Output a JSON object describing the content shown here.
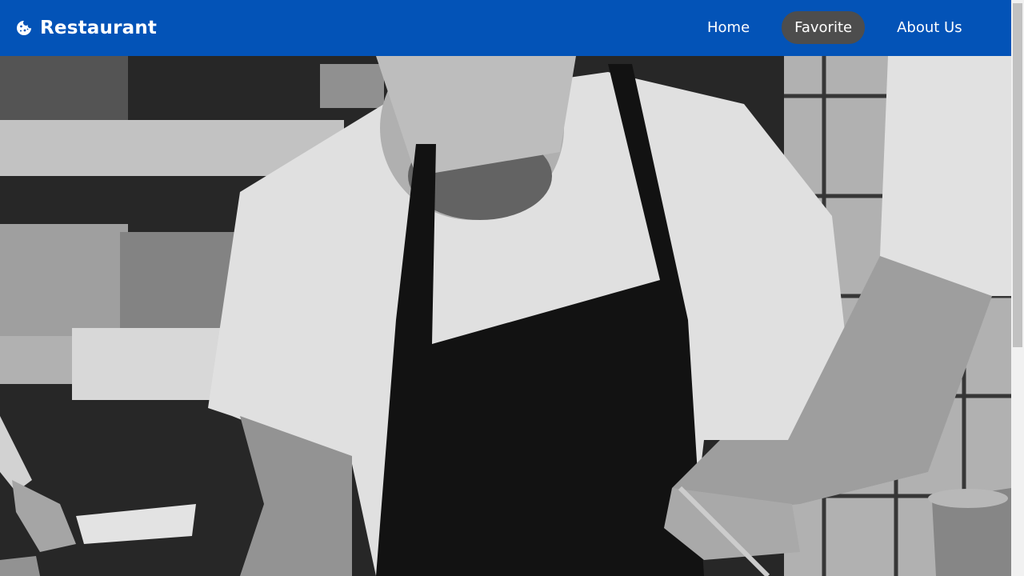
{
  "navbar": {
    "brand_icon": "cookie-icon",
    "brand_text": "Restaurant",
    "links": [
      {
        "label": "Home",
        "active": false
      },
      {
        "label": "Favorite",
        "active": true
      },
      {
        "label": "About Us",
        "active": false
      }
    ]
  },
  "colors": {
    "navbar_bg": "#0353b7",
    "active_link_bg": "#4d4d4d",
    "text": "#ffffff"
  },
  "hero": {
    "image": "chef-cooking-photo"
  }
}
